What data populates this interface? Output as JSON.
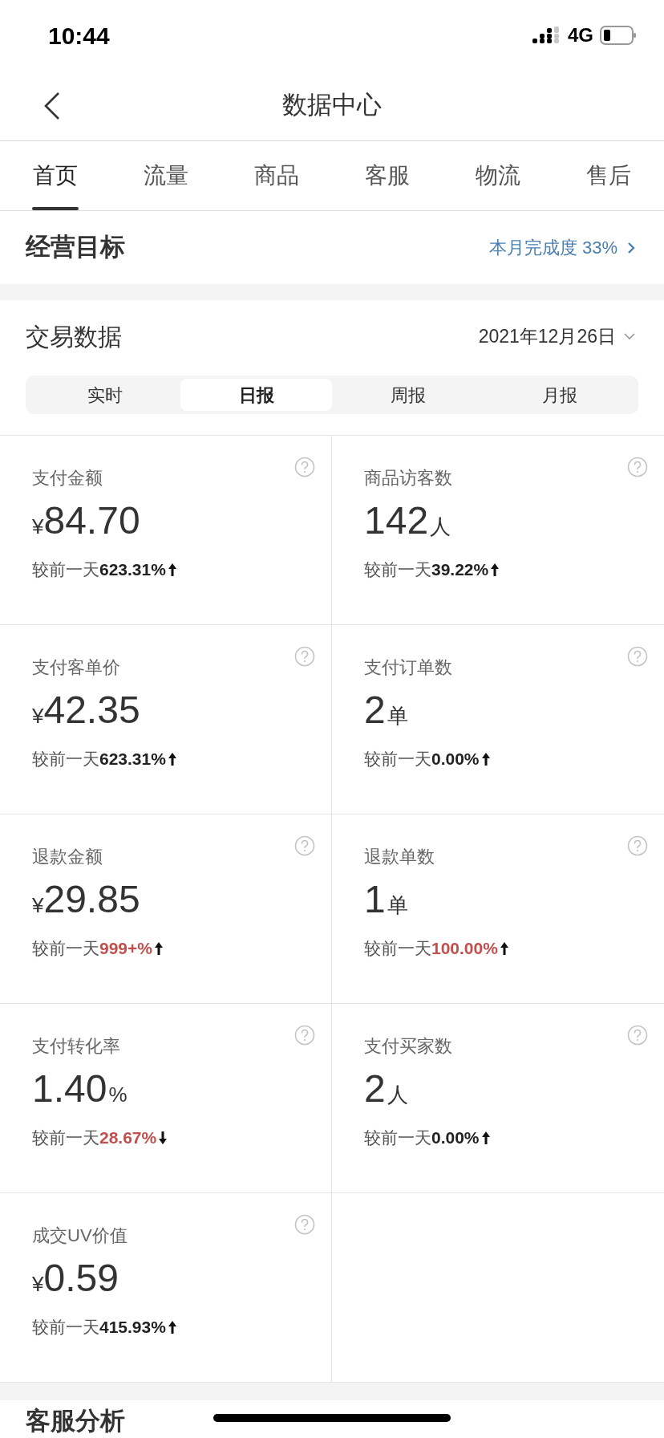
{
  "status_bar": {
    "time": "10:44",
    "network": "4G"
  },
  "nav": {
    "title": "数据中心"
  },
  "tabs": [
    {
      "label": "首页",
      "selected": true
    },
    {
      "label": "流量",
      "selected": false
    },
    {
      "label": "商品",
      "selected": false
    },
    {
      "label": "客服",
      "selected": false
    },
    {
      "label": "物流",
      "selected": false
    },
    {
      "label": "售后",
      "selected": false
    }
  ],
  "goal": {
    "title": "经营目标",
    "progress": "本月完成度 33%"
  },
  "trade": {
    "title": "交易数据",
    "date": "2021年12月26日",
    "periods": [
      {
        "label": "实时",
        "selected": false
      },
      {
        "label": "日报",
        "selected": true
      },
      {
        "label": "周报",
        "selected": false
      },
      {
        "label": "月报",
        "selected": false
      }
    ],
    "metrics": [
      {
        "label": "支付金额",
        "prefix": "¥",
        "value": "84.70",
        "compare": "较前一天",
        "change": "623.31%",
        "rising": true,
        "highlight": false
      },
      {
        "label": "商品访客数",
        "value": "142",
        "unit": "人",
        "compare": "较前一天",
        "change": "39.22%",
        "rising": true,
        "highlight": false
      },
      {
        "label": "支付客单价",
        "prefix": "¥",
        "value": "42.35",
        "compare": "较前一天",
        "change": "623.31%",
        "rising": true,
        "highlight": false
      },
      {
        "label": "支付订单数",
        "value": "2",
        "unit": "单",
        "compare": "较前一天",
        "change": "0.00%",
        "rising": true,
        "highlight": false
      },
      {
        "label": "退款金额",
        "prefix": "¥",
        "value": "29.85",
        "compare": "较前一天",
        "change": "999+%",
        "rising": true,
        "highlight": true
      },
      {
        "label": "退款单数",
        "value": "1",
        "unit": "单",
        "compare": "较前一天",
        "change": "100.00%",
        "rising": true,
        "highlight": true
      },
      {
        "label": "支付转化率",
        "value": "1.40",
        "unit": "%",
        "compare": "较前一天",
        "change": "28.67%",
        "rising": false,
        "highlight": true
      },
      {
        "label": "支付买家数",
        "value": "2",
        "unit": "人",
        "compare": "较前一天",
        "change": "0.00%",
        "rising": true,
        "highlight": false
      },
      {
        "label": "成交UV价值",
        "prefix": "¥",
        "value": "0.59",
        "compare": "较前一天",
        "change": "415.93%",
        "rising": true,
        "highlight": false
      }
    ]
  },
  "next_section": {
    "title": "客服分析"
  }
}
